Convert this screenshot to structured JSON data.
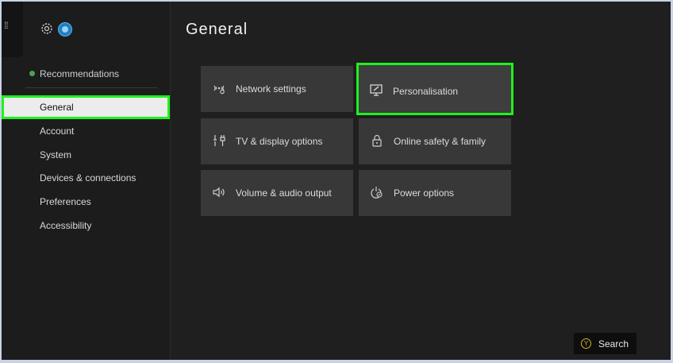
{
  "sidebar": {
    "recommendations_label": "Recommendations",
    "items": [
      {
        "label": "General",
        "selected": true
      },
      {
        "label": "Account"
      },
      {
        "label": "System"
      },
      {
        "label": "Devices & connections"
      },
      {
        "label": "Preferences"
      },
      {
        "label": "Accessibility"
      }
    ],
    "status_dot_color": "#4ea34d"
  },
  "main": {
    "title": "General",
    "tiles": [
      {
        "label": "Network settings",
        "icon": "network-icon"
      },
      {
        "label": "Personalisation",
        "icon": "personalisation-icon",
        "focused": true
      },
      {
        "label": "TV & display options",
        "icon": "tv-display-icon"
      },
      {
        "label": "Online safety & family",
        "icon": "lock-icon"
      },
      {
        "label": "Volume & audio output",
        "icon": "speaker-icon"
      },
      {
        "label": "Power options",
        "icon": "power-icon"
      }
    ]
  },
  "footer": {
    "search_label": "Search",
    "button_glyph": "Y"
  },
  "colors": {
    "focus_highlight": "#1ef21e",
    "y_button": "#d8b21e"
  }
}
